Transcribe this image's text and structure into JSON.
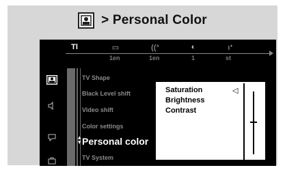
{
  "header": {
    "title": "> Personal Color",
    "icon": "picture-setup-icon"
  },
  "topbar": {
    "tabs": [
      {
        "icon": "settings-tools-icon",
        "glyph": "Tl",
        "active": true
      },
      {
        "icon": "subtitle-icon",
        "glyph": "▭",
        "active": false
      },
      {
        "icon": "audio-language-icon",
        "glyph": "((ᐣ",
        "active": false
      },
      {
        "icon": "angle-icon",
        "glyph": "◐",
        "active": false
      },
      {
        "icon": "sound-mode-icon",
        "glyph": "ıᐩ",
        "active": false
      }
    ],
    "values": [
      "1en",
      "1en",
      "1",
      "st"
    ]
  },
  "left_icons": [
    {
      "icon": "picture-icon",
      "selected": true
    },
    {
      "icon": "speaker-icon",
      "selected": false
    },
    {
      "icon": "language-icon",
      "selected": false
    },
    {
      "icon": "features-icon",
      "selected": false
    }
  ],
  "menu": {
    "items": [
      {
        "label": "TV Shape",
        "selected": false
      },
      {
        "label": "Black Level shift",
        "selected": false
      },
      {
        "label": "Video shift",
        "selected": false
      },
      {
        "label": "Color settings",
        "selected": false
      },
      {
        "label": "Personal color",
        "selected": true
      },
      {
        "label": "TV System",
        "selected": false
      }
    ]
  },
  "submenu": {
    "options": [
      "Saturation",
      "Brightness",
      "Contrast"
    ]
  },
  "colors": {
    "frame": "#d7d7d7",
    "screen": "#000000",
    "accent_bar": "#6a6a6a"
  }
}
